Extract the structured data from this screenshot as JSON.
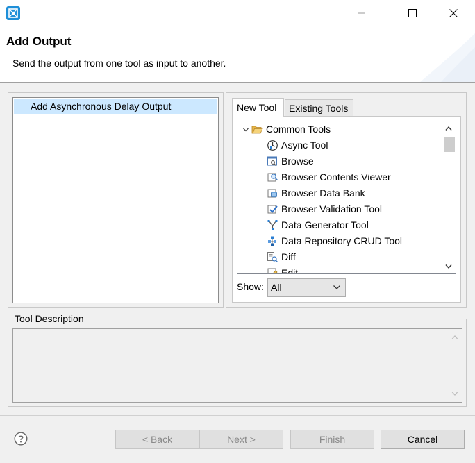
{
  "window": {
    "controls": {
      "minimize": "minimize-icon",
      "maximize": "maximize-icon",
      "close": "close-icon"
    }
  },
  "header": {
    "title": "Add Output",
    "subtitle": "Send the output from one tool as input to another."
  },
  "outputs": {
    "items": [
      "Add Asynchronous Delay Output"
    ],
    "selected_index": 0
  },
  "tabs": [
    {
      "label": "New Tool",
      "active": true
    },
    {
      "label": "Existing Tools",
      "active": false
    }
  ],
  "tree": {
    "folder": {
      "label": "Common Tools",
      "icon": "folder-open-icon",
      "expanded": true
    },
    "items": [
      {
        "label": "Async Tool",
        "icon": "async-tool-icon"
      },
      {
        "label": "Browse",
        "icon": "browse-icon"
      },
      {
        "label": "Browser Contents Viewer",
        "icon": "browser-contents-viewer-icon"
      },
      {
        "label": "Browser Data Bank",
        "icon": "browser-data-bank-icon"
      },
      {
        "label": "Browser Validation Tool",
        "icon": "browser-validation-tool-icon"
      },
      {
        "label": "Data Generator Tool",
        "icon": "data-generator-tool-icon"
      },
      {
        "label": "Data Repository CRUD Tool",
        "icon": "data-repository-crud-tool-icon"
      },
      {
        "label": "Diff",
        "icon": "diff-icon"
      },
      {
        "label": "Edit",
        "icon": "edit-icon"
      }
    ]
  },
  "filter": {
    "label": "Show:",
    "value": "All"
  },
  "description": {
    "label": "Tool Description",
    "text": ""
  },
  "footer": {
    "help_icon": "help-icon",
    "back": "< Back",
    "next": "Next >",
    "finish": "Finish",
    "cancel": "Cancel"
  },
  "colors": {
    "selection": "#cce8ff",
    "accent": "#1e8fd8",
    "disabled_text": "#8a8a8a"
  }
}
